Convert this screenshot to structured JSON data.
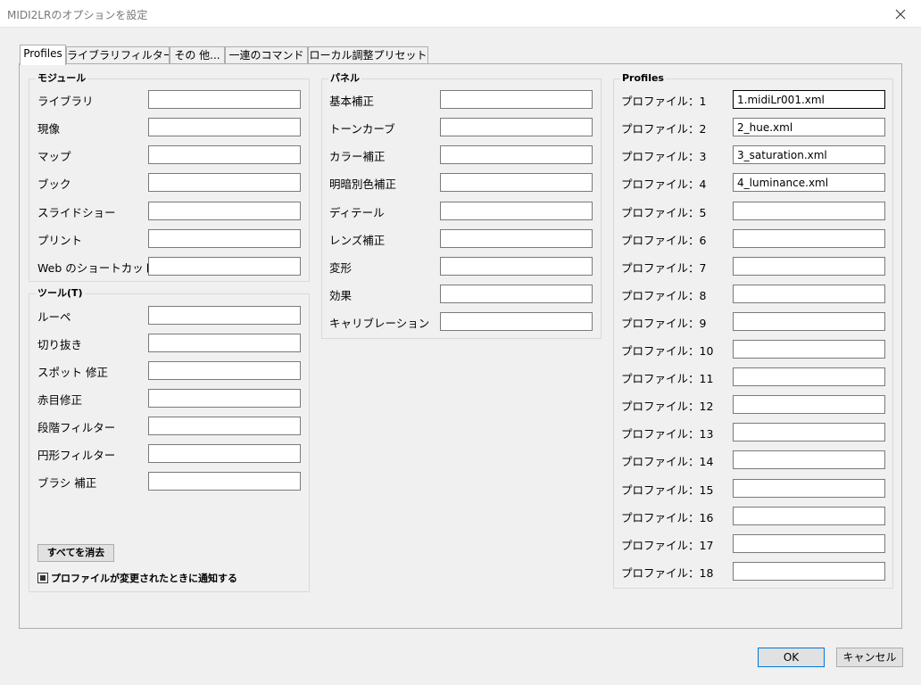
{
  "window": {
    "title": "MIDI2LRのオプションを設定",
    "close_glyph": "✕"
  },
  "tabs": [
    {
      "label": "Profiles"
    },
    {
      "label": "ライブラリフィルター"
    },
    {
      "label": "その 他..."
    },
    {
      "label": "一連のコマンド"
    },
    {
      "label": "ローカル調整プリセット"
    }
  ],
  "modules": {
    "title": "モジュール",
    "items": [
      {
        "label": "ライブラリ",
        "value": ""
      },
      {
        "label": "現像",
        "value": ""
      },
      {
        "label": "マップ",
        "value": ""
      },
      {
        "label": "ブック",
        "value": ""
      },
      {
        "label": "スライドショー",
        "value": ""
      },
      {
        "label": "プリント",
        "value": ""
      },
      {
        "label": "Web のショートカット",
        "value": ""
      }
    ]
  },
  "tools": {
    "title": "ツール(T)",
    "items": [
      {
        "label": "ルーペ",
        "value": ""
      },
      {
        "label": "切り抜き",
        "value": ""
      },
      {
        "label": "スポット 修正",
        "value": ""
      },
      {
        "label": "赤目修正",
        "value": ""
      },
      {
        "label": "段階フィルター",
        "value": ""
      },
      {
        "label": "円形フィルター",
        "value": ""
      },
      {
        "label": "ブラシ 補正",
        "value": ""
      }
    ],
    "clear_all_label": "すべてを消去",
    "notify_label": "プロファイルが変更されたときに通知する",
    "notify_checked": true
  },
  "panels": {
    "title": "パネル",
    "items": [
      {
        "label": "基本補正",
        "value": ""
      },
      {
        "label": "トーンカーブ",
        "value": ""
      },
      {
        "label": "カラー補正",
        "value": ""
      },
      {
        "label": "明暗別色補正",
        "value": ""
      },
      {
        "label": "ディテール",
        "value": ""
      },
      {
        "label": "レンズ補正",
        "value": ""
      },
      {
        "label": "変形",
        "value": ""
      },
      {
        "label": "効果",
        "value": ""
      },
      {
        "label": "キャリブレーション",
        "value": ""
      }
    ]
  },
  "profiles": {
    "title": "Profiles",
    "items": [
      {
        "label": "プロファイル：1",
        "value": "1.midiLr001.xml"
      },
      {
        "label": "プロファイル：2",
        "value": "2_hue.xml"
      },
      {
        "label": "プロファイル：3",
        "value": "3_saturation.xml"
      },
      {
        "label": "プロファイル：4",
        "value": "4_luminance.xml"
      },
      {
        "label": "プロファイル：5",
        "value": ""
      },
      {
        "label": "プロファイル：6",
        "value": ""
      },
      {
        "label": "プロファイル：7",
        "value": ""
      },
      {
        "label": "プロファイル：8",
        "value": ""
      },
      {
        "label": "プロファイル：9",
        "value": ""
      },
      {
        "label": "プロファイル：10",
        "value": ""
      },
      {
        "label": "プロファイル：11",
        "value": ""
      },
      {
        "label": "プロファイル：12",
        "value": ""
      },
      {
        "label": "プロファイル：13",
        "value": ""
      },
      {
        "label": "プロファイル：14",
        "value": ""
      },
      {
        "label": "プロファイル：15",
        "value": ""
      },
      {
        "label": "プロファイル：16",
        "value": ""
      },
      {
        "label": "プロファイル：17",
        "value": ""
      },
      {
        "label": "プロファイル：18",
        "value": ""
      }
    ]
  },
  "footer": {
    "ok_label": "OK",
    "cancel_label": "キャンセル"
  }
}
